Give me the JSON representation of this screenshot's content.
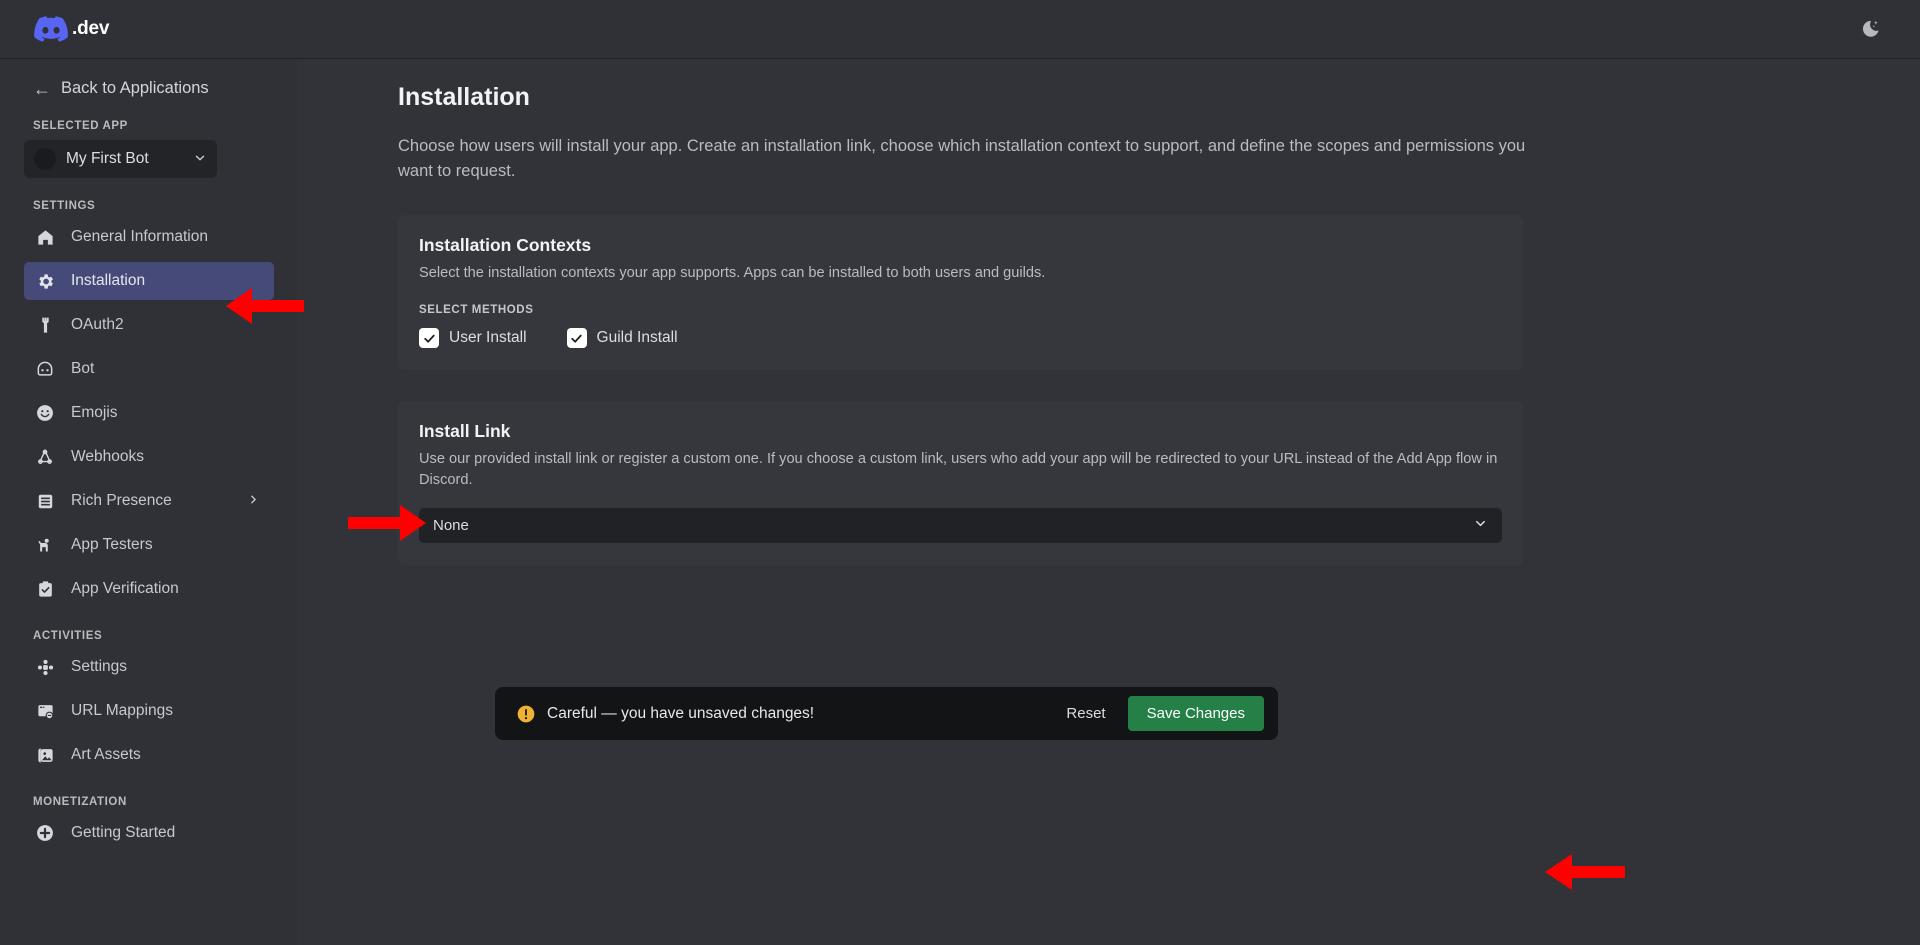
{
  "topbar": {
    "brand_text": ".dev",
    "brand_icon": "discord-logo-icon",
    "theme_toggle_icon": "moon-icon"
  },
  "sidebar": {
    "back_label": "Back to Applications",
    "back_icon": "arrow-left-icon",
    "selected_app_label": "SELECTED APP",
    "selected_app_name": "My First Bot",
    "selected_app_chevron": "chevron-down-icon",
    "settings_label": "SETTINGS",
    "settings_items": [
      {
        "label": "General Information",
        "icon": "home-icon",
        "active": false
      },
      {
        "label": "Installation",
        "icon": "gear-icon",
        "active": true
      },
      {
        "label": "OAuth2",
        "icon": "wrench-icon",
        "active": false
      },
      {
        "label": "Bot",
        "icon": "robot-icon",
        "active": false
      },
      {
        "label": "Emojis",
        "icon": "smiley-icon",
        "active": false
      },
      {
        "label": "Webhooks",
        "icon": "webhook-icon",
        "active": false
      },
      {
        "label": "Rich Presence",
        "icon": "list-icon",
        "active": false,
        "has_chevron": true
      },
      {
        "label": "App Testers",
        "icon": "person-raise-hand-icon",
        "active": false
      },
      {
        "label": "App Verification",
        "icon": "clipboard-check-icon",
        "active": false
      }
    ],
    "activities_label": "ACTIVITIES",
    "activities_items": [
      {
        "label": "Settings",
        "icon": "dpad-icon"
      },
      {
        "label": "URL Mappings",
        "icon": "browser-link-icon"
      },
      {
        "label": "Art Assets",
        "icon": "image-icon"
      }
    ],
    "monetization_label": "MONETIZATION",
    "monetization_items": [
      {
        "label": "Getting Started",
        "icon": "plus-circle-icon"
      }
    ]
  },
  "main": {
    "title": "Installation",
    "description": "Choose how users will install your app. Create an installation link, choose which installation context to support, and define the scopes and permissions you want to request.",
    "contexts_card": {
      "title": "Installation Contexts",
      "description": "Select the installation contexts your app supports. Apps can be installed to both users and guilds.",
      "field_label": "SELECT METHODS",
      "checkboxes": [
        {
          "label": "User Install",
          "checked": true
        },
        {
          "label": "Guild Install",
          "checked": true
        }
      ]
    },
    "install_link_card": {
      "title": "Install Link",
      "description": "Use our provided install link or register a custom one. If you choose a custom link, users who add your app will be redirected to your URL instead of the Add App flow in Discord.",
      "select_value": "None",
      "select_chevron": "chevron-down-icon"
    }
  },
  "savebar": {
    "icon": "warning-icon",
    "message": "Careful — you have unsaved changes!",
    "reset_label": "Reset",
    "save_label": "Save Changes"
  },
  "colors": {
    "accent_active": "#454a79",
    "save_green": "#248046",
    "warning_yellow": "#f0b232",
    "annotation_red": "#ff0000",
    "brand_blurple": "#5865f2"
  }
}
